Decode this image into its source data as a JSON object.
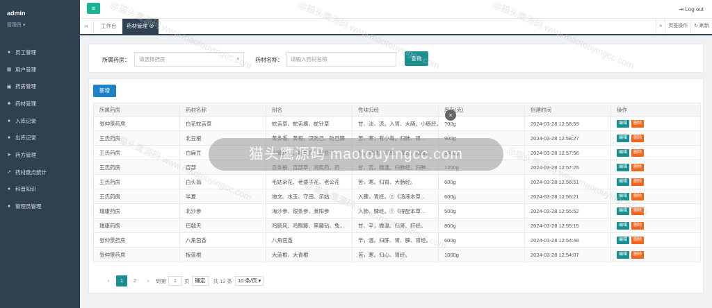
{
  "sidebar": {
    "username": "admin",
    "role": "管理员 ▾",
    "items": [
      {
        "label": "员工管理",
        "icon": "user-icon"
      },
      {
        "label": "用户管理",
        "icon": "table-icon"
      },
      {
        "label": "药房管理",
        "icon": "building-icon"
      },
      {
        "label": "药材管理",
        "icon": "leaf-icon"
      },
      {
        "label": "入库记录",
        "icon": "list-icon"
      },
      {
        "label": "出库记录",
        "icon": "list-icon"
      },
      {
        "label": "药方管理",
        "icon": "send-icon"
      },
      {
        "label": "药材盘点统计",
        "icon": "line-chart-icon"
      },
      {
        "label": "科普知识",
        "icon": "comment-icon"
      },
      {
        "label": "管理员管理",
        "icon": "user-icon"
      }
    ]
  },
  "topbar": {
    "menu_icon": "≡",
    "logout": "Log out"
  },
  "tabs": {
    "items": [
      {
        "label": "工作台"
      },
      {
        "label": "药材管理"
      }
    ],
    "page_ops": "页签操作",
    "refresh": "刷新"
  },
  "search": {
    "pharmacy_label": "所属药房：",
    "pharmacy_placeholder": "请选择药房",
    "name_label": "药材名称：",
    "name_placeholder": "请输入药材名称",
    "query_button": "查询"
  },
  "toolbar": {
    "add_button": "新增"
  },
  "table": {
    "headers": [
      "所属药房",
      "药材名称",
      "别名",
      "性味归经",
      "库存(克)",
      "创建时间",
      "操作"
    ],
    "rows": [
      [
        "张仲景药房",
        "白花蛇舌草",
        "蛇舌草、蛇舌癀、蛇针草",
        "甘、淡、凉。入胃、大肠、小肠经。",
        "?00g",
        "2024-03-28 12:58:59"
      ],
      [
        "王氏药房",
        "北豆根",
        "黄条香、黄根、汉防己、防己藤",
        "苦、寒；有小毒。归肺、胃...",
        "900g",
        "2024-03-28 12:58:27"
      ],
      [
        "王氏药房",
        "白扁豆",
        "火镰扁豆、峨眉豆、扁豆子...",
        "甘，微温。归脾、胃经。归脾...",
        "1500g",
        "2024-03-28 12:57:56"
      ],
      [
        "王氏药房",
        "百部",
        "百条根、百部草、闹虱药、药...",
        "甘、苦，微温。归肺经。归肺...",
        "1200g",
        "2024-03-28 12:57:25"
      ],
      [
        "王氏药房",
        "白头翁",
        "毛姑朵花、老婆子花、老公花",
        "苦，寒。归胃、大肠经。",
        "600g",
        "2024-03-28 12:56:51"
      ],
      [
        "王氏药房",
        "半夏",
        "地文、水玉、守田、示姑",
        "入脾，胃经。①《汤液本草...",
        "600g",
        "2024-03-28 12:56:21"
      ],
      [
        "瑞康药房",
        "北沙参",
        "海沙参、银条参、莱阳参",
        "入肺、脾经。①《得配本草...",
        "500g",
        "2024-03-28 12:55:52"
      ],
      [
        "瑞康药房",
        "巴戟天",
        "鸡肠风、鸡眼藤、黑藤钻、兔...",
        "甘、辛，微温。归肾、肝经。",
        "800g",
        "2024-03-28 12:55:15"
      ],
      [
        "张仲景药房",
        "八角茴香",
        "八角茴香",
        "辛，温。归肝、肾、脾、胃经。",
        "600g",
        "2024-03-28 12:54:48"
      ],
      [
        "张仲景药房",
        "板蓝根",
        "大蓝根、大青根",
        "苦，寒。归心、胃经。",
        "1000g",
        "2024-03-28 12:54:07"
      ]
    ],
    "edit_label": "编辑",
    "delete_label": "删除"
  },
  "pagination": {
    "prev": "‹",
    "pages": [
      "1",
      "2"
    ],
    "next": "›",
    "goto_label": "到第",
    "goto_value": "1",
    "page_unit": "页",
    "confirm": "确定",
    "total": "共 12 条",
    "page_size": "10 条/页 ▾"
  },
  "overlay": {
    "banner": "猫头鹰源码 maotouyingcc.com",
    "watermark": "@猫头鹰源码 www.maotouyingcc.com",
    "close": "×"
  },
  "colors": {
    "sidebar": "#2f4050",
    "primary": "#1a8f8f",
    "blue": "#1c84c6",
    "danger": "#f0661d"
  }
}
